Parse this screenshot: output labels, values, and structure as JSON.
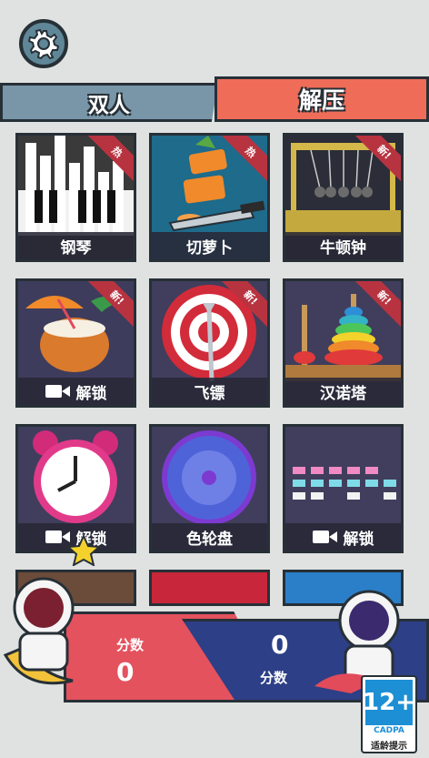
{
  "tabs": {
    "left": "双人",
    "right": "解压"
  },
  "tiles": [
    {
      "label": "钢琴",
      "ribbon": "热",
      "unlock": false
    },
    {
      "label": "切萝卜",
      "ribbon": "热",
      "unlock": false
    },
    {
      "label": "牛顿钟",
      "ribbon": "新!",
      "unlock": false
    },
    {
      "label": "解锁",
      "ribbon": "新!",
      "unlock": true
    },
    {
      "label": "飞镖",
      "ribbon": "新!",
      "unlock": false
    },
    {
      "label": "汉诺塔",
      "ribbon": "新!",
      "unlock": false
    },
    {
      "label": "解锁",
      "ribbon": "",
      "unlock": true
    },
    {
      "label": "色轮盘",
      "ribbon": "",
      "unlock": false
    },
    {
      "label": "解锁",
      "ribbon": "",
      "unlock": true
    }
  ],
  "score": {
    "left_label": "分数",
    "left_value": "0",
    "right_label": "分数",
    "right_value": "0"
  },
  "badge": {
    "age": "12+",
    "org": "CADPA",
    "text": "适龄提示"
  },
  "colors": {
    "accent": "#ef6d58",
    "tab_inactive": "#7896a8",
    "outline": "#273037"
  }
}
